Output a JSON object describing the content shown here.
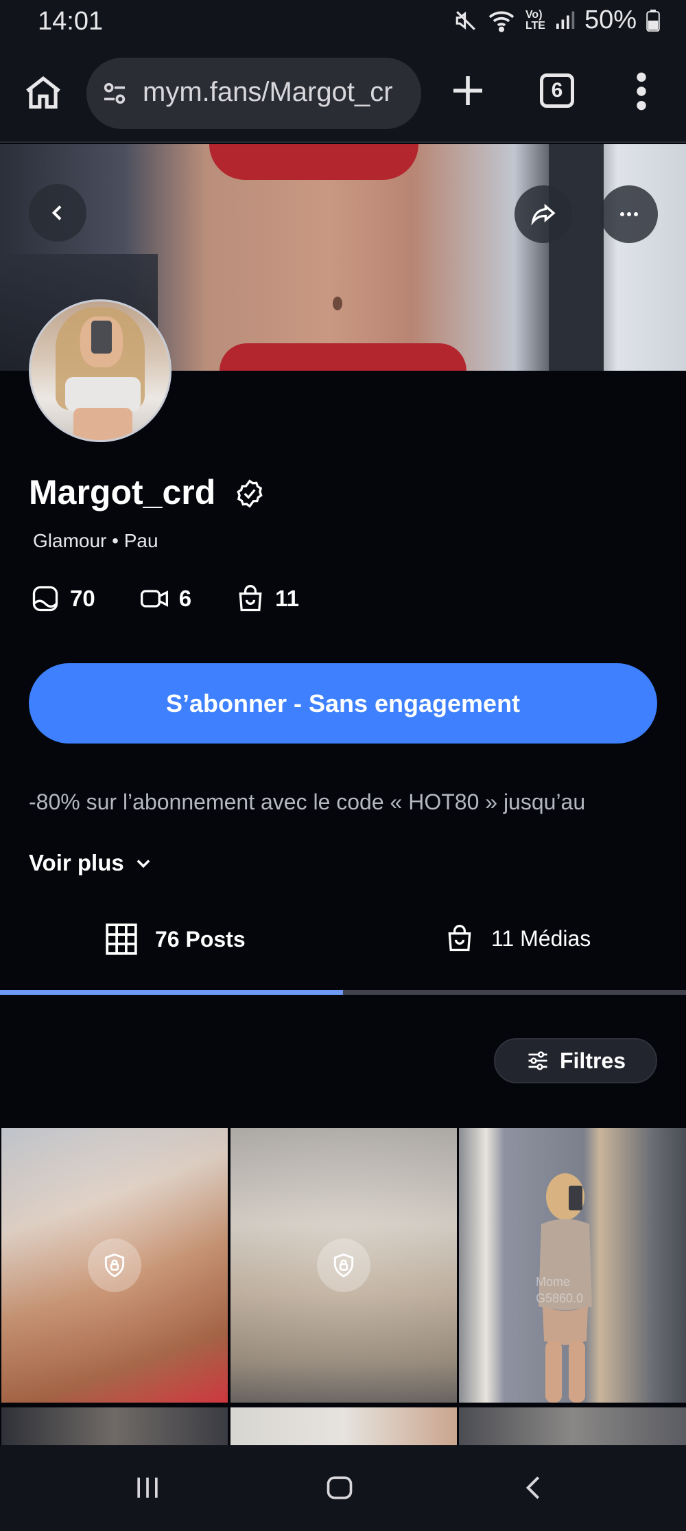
{
  "status_bar": {
    "time": "14:01",
    "battery": "50%",
    "network": "Vo) LTE"
  },
  "browser": {
    "url": "mym.fans/Margot_cr",
    "tab_count": "6"
  },
  "profile": {
    "username": "Margot_crd",
    "category": "Glamour • Pau",
    "stats": {
      "photos": "70",
      "videos": "6",
      "shop": "11"
    },
    "subscribe_label": "S’abonner - Sans engagement",
    "promo_text": "-80% sur l’abonnement avec le code « HOT80 » jusqu’au",
    "see_more_label": "Voir plus"
  },
  "tabs": {
    "posts_label": "76 Posts",
    "medias_label": "11 Médias",
    "active": "posts"
  },
  "filters_label": "Filtres",
  "grid": {
    "watermark": "Mome\nG5860.0"
  },
  "colors": {
    "accent": "#3e80fd",
    "tab_indicator": "#6e9af5",
    "background": "#04060c"
  },
  "icons": {
    "home": "home-icon",
    "site_settings": "tune-icon",
    "new_tab": "plus-icon",
    "menu": "more-vertical-icon",
    "back": "chevron-left-icon",
    "share": "share-icon",
    "more": "more-horizontal-icon",
    "verified": "verified-badge-icon",
    "photos": "image-icon",
    "videos": "video-icon",
    "shop": "shopping-bag-icon",
    "see_more": "chevron-down-icon",
    "posts_tab": "grid-icon",
    "medias_tab": "shopping-bag-icon",
    "filters": "sliders-icon",
    "lock": "lock-shield-icon"
  }
}
